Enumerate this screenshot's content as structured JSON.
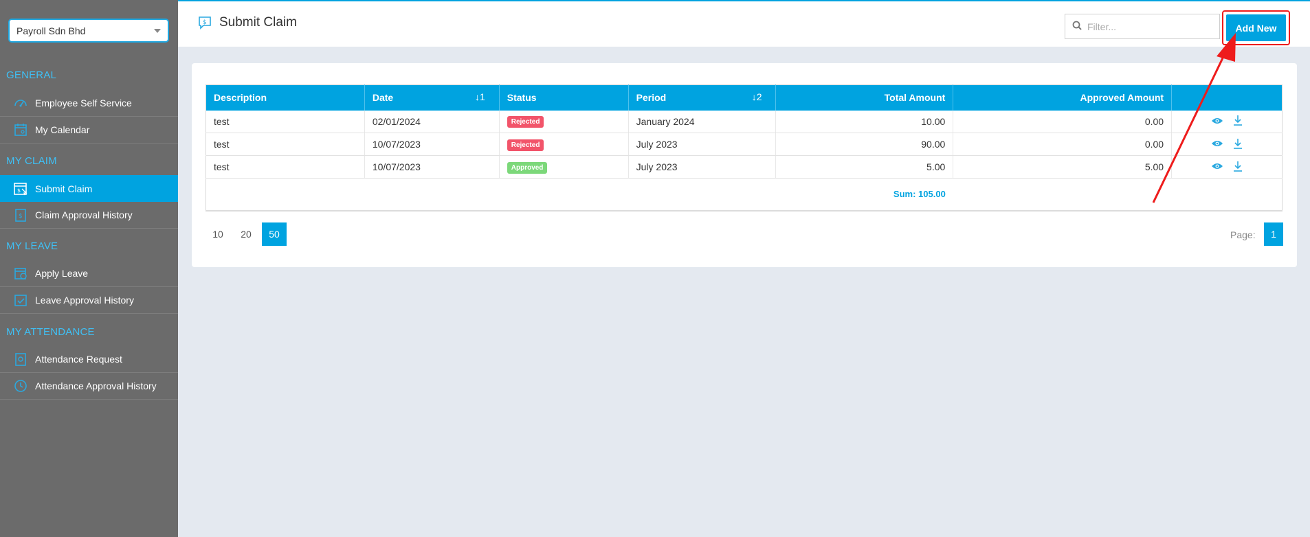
{
  "sidebar": {
    "company": "Payroll Sdn Bhd",
    "sections": [
      {
        "title": "GENERAL",
        "items": [
          {
            "label": "Employee Self Service"
          },
          {
            "label": "My Calendar"
          }
        ]
      },
      {
        "title": "MY CLAIM",
        "items": [
          {
            "label": "Submit Claim"
          },
          {
            "label": "Claim Approval History"
          }
        ]
      },
      {
        "title": "MY LEAVE",
        "items": [
          {
            "label": "Apply Leave"
          },
          {
            "label": "Leave Approval History"
          }
        ]
      },
      {
        "title": "MY ATTENDANCE",
        "items": [
          {
            "label": "Attendance Request"
          },
          {
            "label": "Attendance Approval History"
          }
        ]
      }
    ]
  },
  "header": {
    "title": "Submit Claim",
    "filter_placeholder": "Filter...",
    "add_new_label": "Add New"
  },
  "table": {
    "columns": [
      "Description",
      "Date",
      "Status",
      "Period",
      "Total Amount",
      "Approved Amount"
    ],
    "sort_date": "↓1",
    "sort_period": "↓2",
    "rows": [
      {
        "description": "test",
        "date": "02/01/2024",
        "status": "Rejected",
        "period": "January 2024",
        "total": "10.00",
        "approved": "0.00"
      },
      {
        "description": "test",
        "date": "10/07/2023",
        "status": "Rejected",
        "period": "July 2023",
        "total": "90.00",
        "approved": "0.00"
      },
      {
        "description": "test",
        "date": "10/07/2023",
        "status": "Approved",
        "period": "July 2023",
        "total": "5.00",
        "approved": "5.00"
      }
    ],
    "sum": "Sum: 105.00"
  },
  "pagination": {
    "sizes": [
      "10",
      "20",
      "50"
    ],
    "active_size": "50",
    "page_label": "Page:",
    "current_page": "1"
  },
  "colors": {
    "accent": "#00a3e0",
    "sidebar_bg": "#6b6b6b",
    "rejected": "#f2546a",
    "approved": "#7cd87a",
    "annotation": "#ee1c1c"
  }
}
